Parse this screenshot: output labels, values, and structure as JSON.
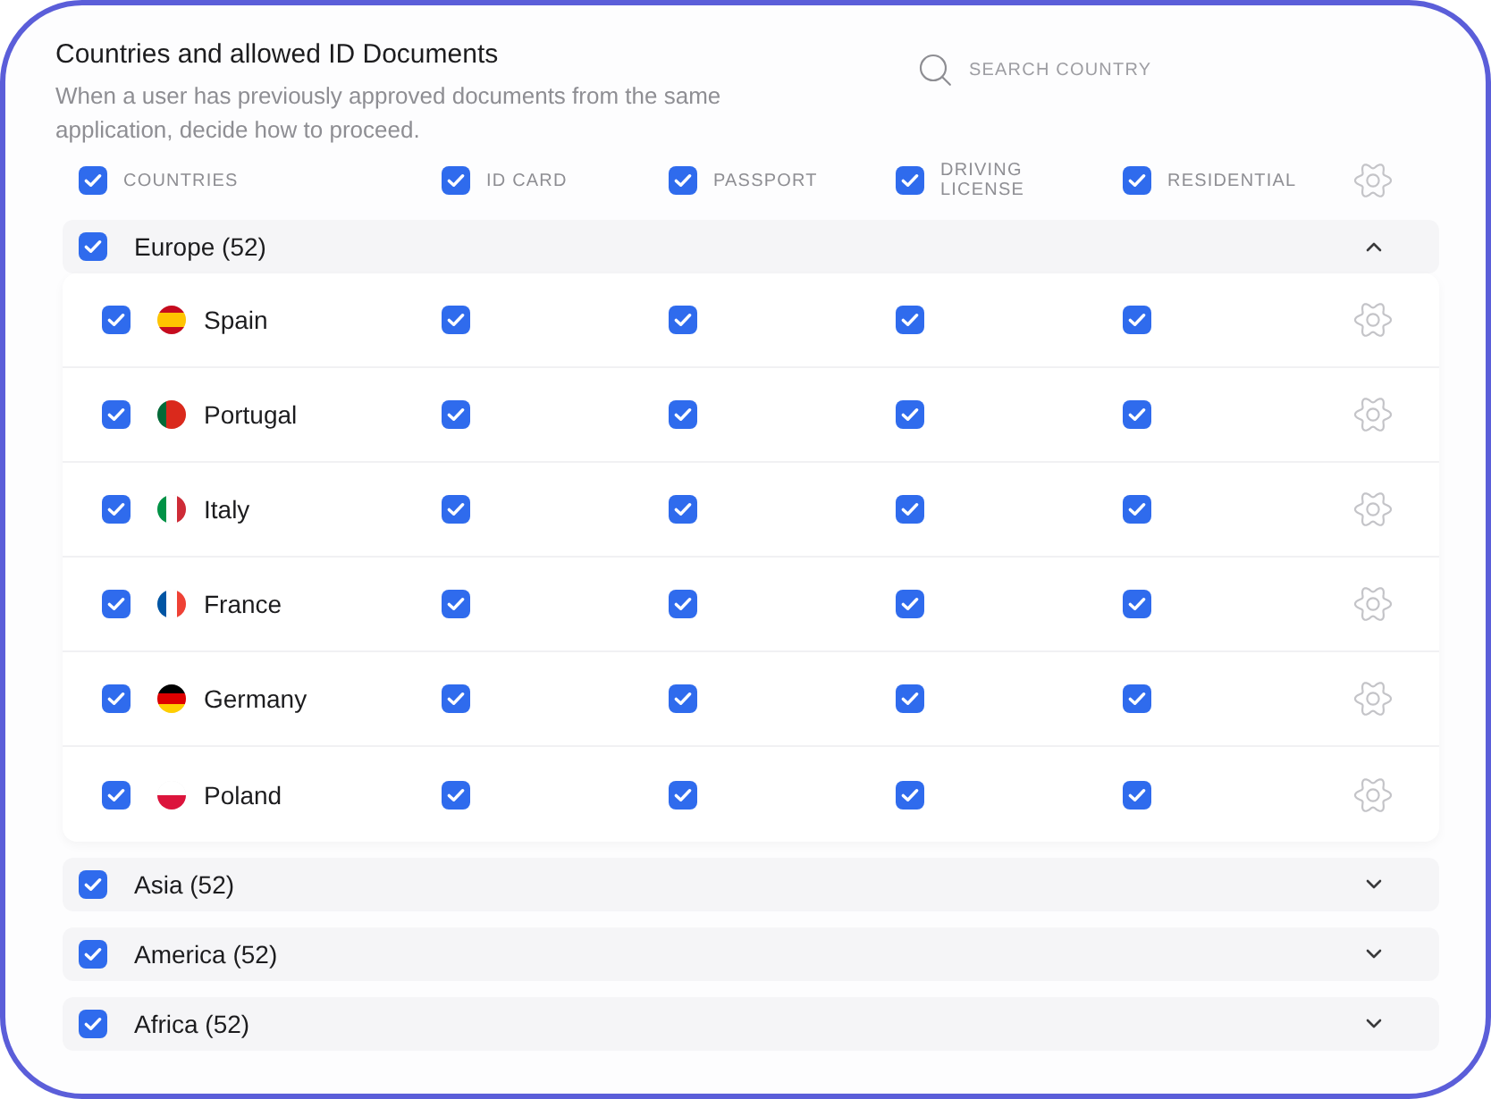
{
  "title": "Countries and allowed ID Documents",
  "description": "When a user has previously approved documents from the same application, decide how to proceed.",
  "search": {
    "placeholder": "SEARCH COUNTRY"
  },
  "columns": [
    {
      "label": "COUNTRIES",
      "checked": true
    },
    {
      "label": "ID CARD",
      "checked": true
    },
    {
      "label": "PASSPORT",
      "checked": true
    },
    {
      "label": "DRIVING LICENSE",
      "checked": true
    },
    {
      "label": "RESIDENTIAL",
      "checked": true
    }
  ],
  "regions": [
    {
      "label": "Europe (52)",
      "checked": true,
      "expanded": true,
      "countries": [
        {
          "name": "Spain",
          "checked": true,
          "flag": {
            "kind": "horizontal",
            "stripes": [
              {
                "color": "#c60b1e"
              },
              {
                "color": "#ffc400"
              },
              {
                "color": "#ffc400"
              },
              {
                "color": "#c60b1e"
              }
            ]
          },
          "documents": [
            {
              "checked": true
            },
            {
              "checked": true
            },
            {
              "checked": true
            },
            {
              "checked": true
            }
          ]
        },
        {
          "name": "Portugal",
          "checked": true,
          "flag": {
            "kind": "vertical",
            "stripes": [
              {
                "color": "#046a38"
              },
              {
                "color": "#da291c"
              },
              {
                "color": "#da291c"
              }
            ]
          },
          "documents": [
            {
              "checked": true
            },
            {
              "checked": true
            },
            {
              "checked": true
            },
            {
              "checked": true
            }
          ]
        },
        {
          "name": "Italy",
          "checked": true,
          "flag": {
            "kind": "vertical",
            "stripes": [
              {
                "color": "#009246"
              },
              {
                "color": "#ffffff"
              },
              {
                "color": "#ce2b37"
              }
            ]
          },
          "documents": [
            {
              "checked": true
            },
            {
              "checked": true
            },
            {
              "checked": true
            },
            {
              "checked": true
            }
          ]
        },
        {
          "name": "France",
          "checked": true,
          "flag": {
            "kind": "vertical",
            "stripes": [
              {
                "color": "#0055a4"
              },
              {
                "color": "#ffffff"
              },
              {
                "color": "#ef4135"
              }
            ]
          },
          "documents": [
            {
              "checked": true
            },
            {
              "checked": true
            },
            {
              "checked": true
            },
            {
              "checked": true
            }
          ]
        },
        {
          "name": "Germany",
          "checked": true,
          "flag": {
            "kind": "horizontal",
            "stripes": [
              {
                "color": "#000000"
              },
              {
                "color": "#dd0000"
              },
              {
                "color": "#ffce00"
              }
            ]
          },
          "documents": [
            {
              "checked": true
            },
            {
              "checked": true
            },
            {
              "checked": true
            },
            {
              "checked": true
            }
          ]
        },
        {
          "name": "Poland",
          "checked": true,
          "flag": {
            "kind": "horizontal",
            "stripes": [
              {
                "color": "#ffffff"
              },
              {
                "color": "#dc143c"
              }
            ]
          },
          "documents": [
            {
              "checked": true
            },
            {
              "checked": true
            },
            {
              "checked": true
            },
            {
              "checked": true
            }
          ]
        }
      ]
    },
    {
      "label": "Asia (52)",
      "checked": true,
      "expanded": false
    },
    {
      "label": "America (52)",
      "checked": true,
      "expanded": false
    },
    {
      "label": "Africa (52)",
      "checked": true,
      "expanded": false
    }
  ]
}
